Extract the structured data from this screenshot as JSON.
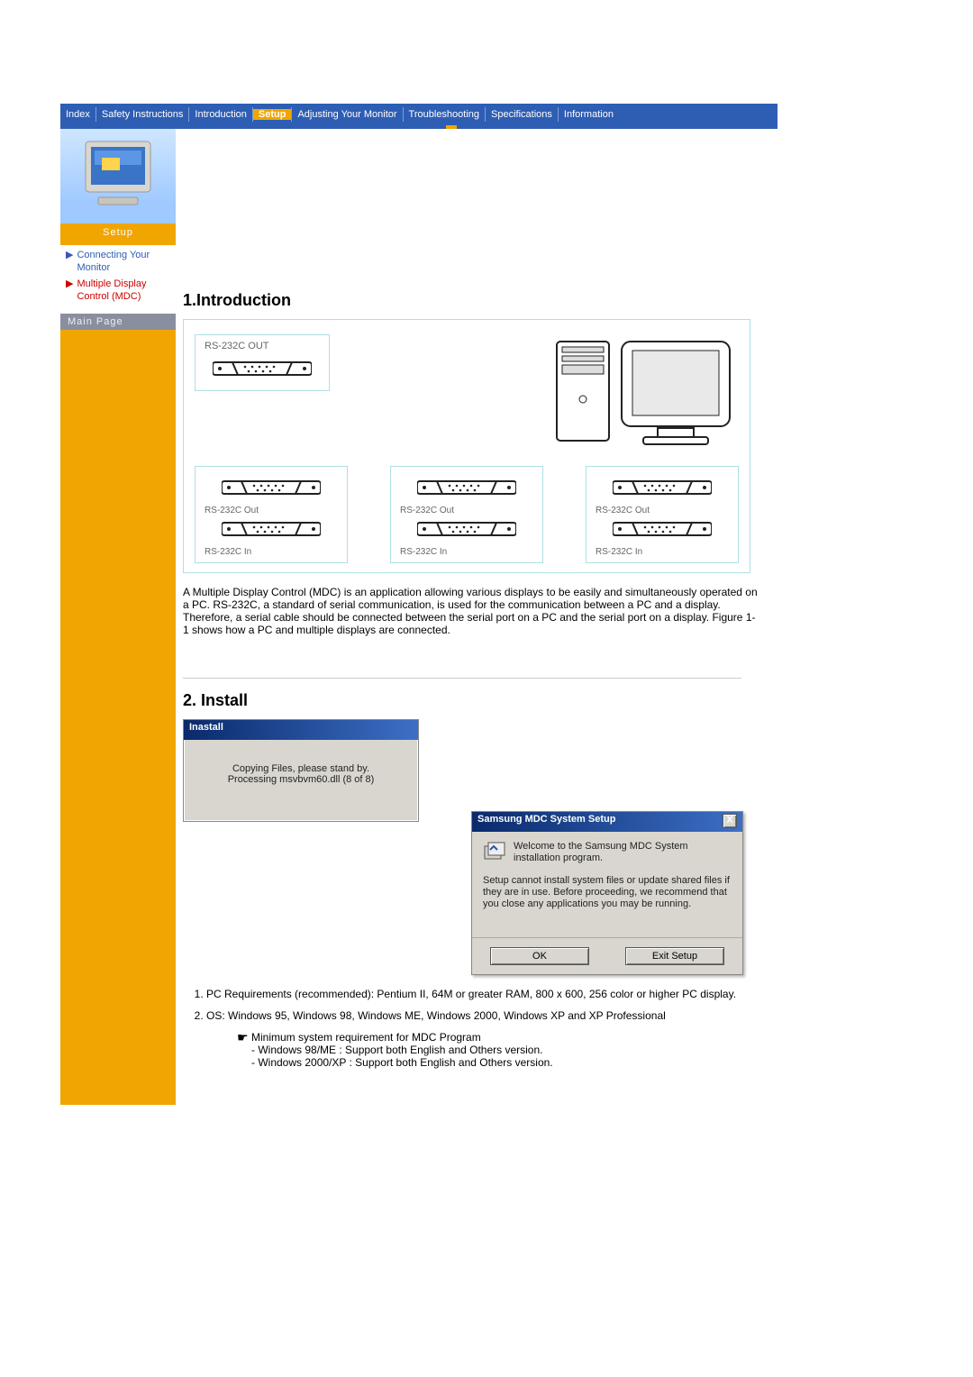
{
  "nav": {
    "items": [
      {
        "label": "Index"
      },
      {
        "label": "Safety Instructions"
      },
      {
        "label": "Introduction"
      },
      {
        "label": "Setup",
        "current": true
      },
      {
        "label": "Adjusting Your Monitor"
      },
      {
        "label": "Troubleshooting"
      },
      {
        "label": "Specifications"
      },
      {
        "label": "Information"
      }
    ]
  },
  "sidebar": {
    "section_label": "Setup",
    "links": [
      {
        "label": "Connecting Your Monitor",
        "active": false
      },
      {
        "label": "Multiple Display Control (MDC)",
        "active": true
      }
    ],
    "main_page_label": "Main Page"
  },
  "intro": {
    "heading": "1.Introduction",
    "top_port_label": "RS-232C OUT",
    "bottom_ports": [
      {
        "out": "RS-232C Out",
        "in": "RS-232C In"
      },
      {
        "out": "RS-232C Out",
        "in": "RS-232C In"
      },
      {
        "out": "RS-232C Out",
        "in": "RS-232C In"
      }
    ],
    "paragraph": "A Multiple Display Control (MDC) is an application allowing various displays to be easily and simultaneously operated on a PC. RS-232C, a standard of serial communication, is used for the communication between a PC and a display. Therefore, a serial cable should be connected between the serial port on a PC and the serial port on a display. Figure 1-1 shows how a PC and multiple displays are connected."
  },
  "install": {
    "heading": "2. Install",
    "copy_dialog": {
      "title": "Inastall",
      "line1": "Copying Files, please stand by.",
      "line2": "Processing msvbvm60.dll (8 of 8)"
    },
    "setup_dialog": {
      "title": "Samsung MDC System Setup",
      "close": "X",
      "welcome": "Welcome to the Samsung MDC System installation program.",
      "body": "Setup cannot install system files or update shared files if they are in use. Before proceeding, we recommend that you close any applications you may be running.",
      "ok": "OK",
      "exit": "Exit Setup"
    },
    "reqs": [
      "PC Requirements (recommended): Pentium II, 64M or greater RAM, 800 x 600, 256 color or higher PC display.",
      "OS: Windows 95, Windows 98, Windows ME, Windows 2000, Windows XP and XP Professional"
    ],
    "note": {
      "title": "Minimum system requirement for MDC Program",
      "line1": "- Windows 98/ME : Support both English and Others version.",
      "line2": "- Windows 2000/XP : Support both English and Others version."
    }
  }
}
